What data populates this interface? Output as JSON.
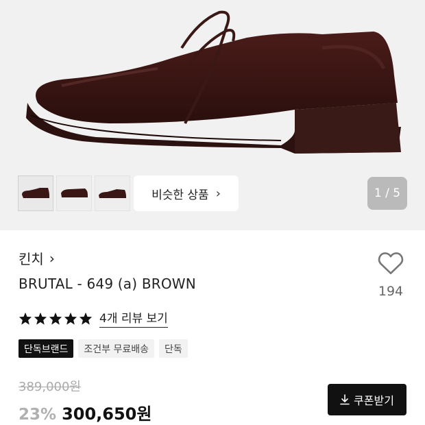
{
  "gallery": {
    "similar_label": "비슷한 상품",
    "counter": "1 / 5",
    "thumbnails": [
      "shoe-thumbnail-1",
      "shoe-thumbnail-2",
      "shoe-thumbnail-3"
    ]
  },
  "product": {
    "brand": "킨치",
    "name": "BRUTAL - 649 (a) BROWN",
    "likes": "194",
    "rating": 5,
    "review_link": "4개 리뷰 보기",
    "badges": [
      "단독브랜드",
      "조건부 무료배송",
      "단독"
    ],
    "original_price": "389,000원",
    "discount": "23%",
    "price": "300,650원",
    "coupon_label": "쿠폰받기"
  },
  "colors": {
    "hero_bg": "#f1f1f1",
    "shoe_leather": "#3a1614",
    "coupon_bg": "#111111"
  },
  "icons": {
    "like": "heart-outline-icon",
    "star": "star-icon",
    "download": "download-icon",
    "chevron": "chevron-right-icon"
  }
}
